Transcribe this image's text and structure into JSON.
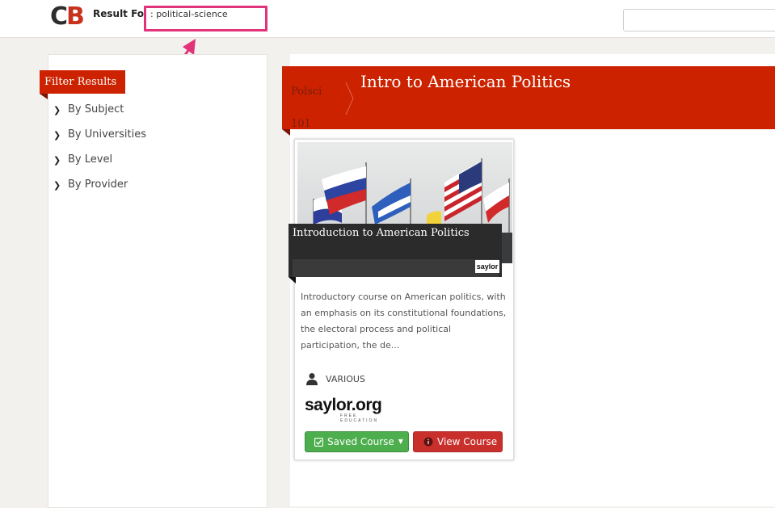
{
  "header": {
    "logo": {
      "letter1": "C",
      "letter2": "B"
    },
    "result_label": "Result Fo",
    "query": ": political-science",
    "search": {
      "placeholder": "",
      "value": ""
    }
  },
  "sidebar": {
    "title": "Filter Results",
    "filters": [
      {
        "label": "By Subject"
      },
      {
        "label": "By Universities"
      },
      {
        "label": "By Level"
      },
      {
        "label": "By Provider"
      }
    ]
  },
  "course": {
    "code_line1": "Polsci",
    "code_line2": "101",
    "title": "Intro to American Politics"
  },
  "card": {
    "title": "Introduction to American Politics",
    "badge": "saylor",
    "description": "Introductory course on American politics, with an emphasis on its constitutional foundations, the electoral process and political participation, the de...",
    "instructor": "VARIOUS",
    "provider_logo": "saylor.org",
    "provider_tagline": "FREE EDUCATION",
    "saved_button": "Saved Course",
    "view_button": "View Course"
  },
  "colors": {
    "brand_red": "#cc2200",
    "highlight_pink": "#e0337a",
    "saved_green": "#4cae4c",
    "view_red": "#c9302c"
  },
  "icons": [
    "person-icon",
    "check-icon",
    "caret-down-icon",
    "info-icon",
    "chevron-right-icon",
    "arrow-annotation-icon"
  ]
}
